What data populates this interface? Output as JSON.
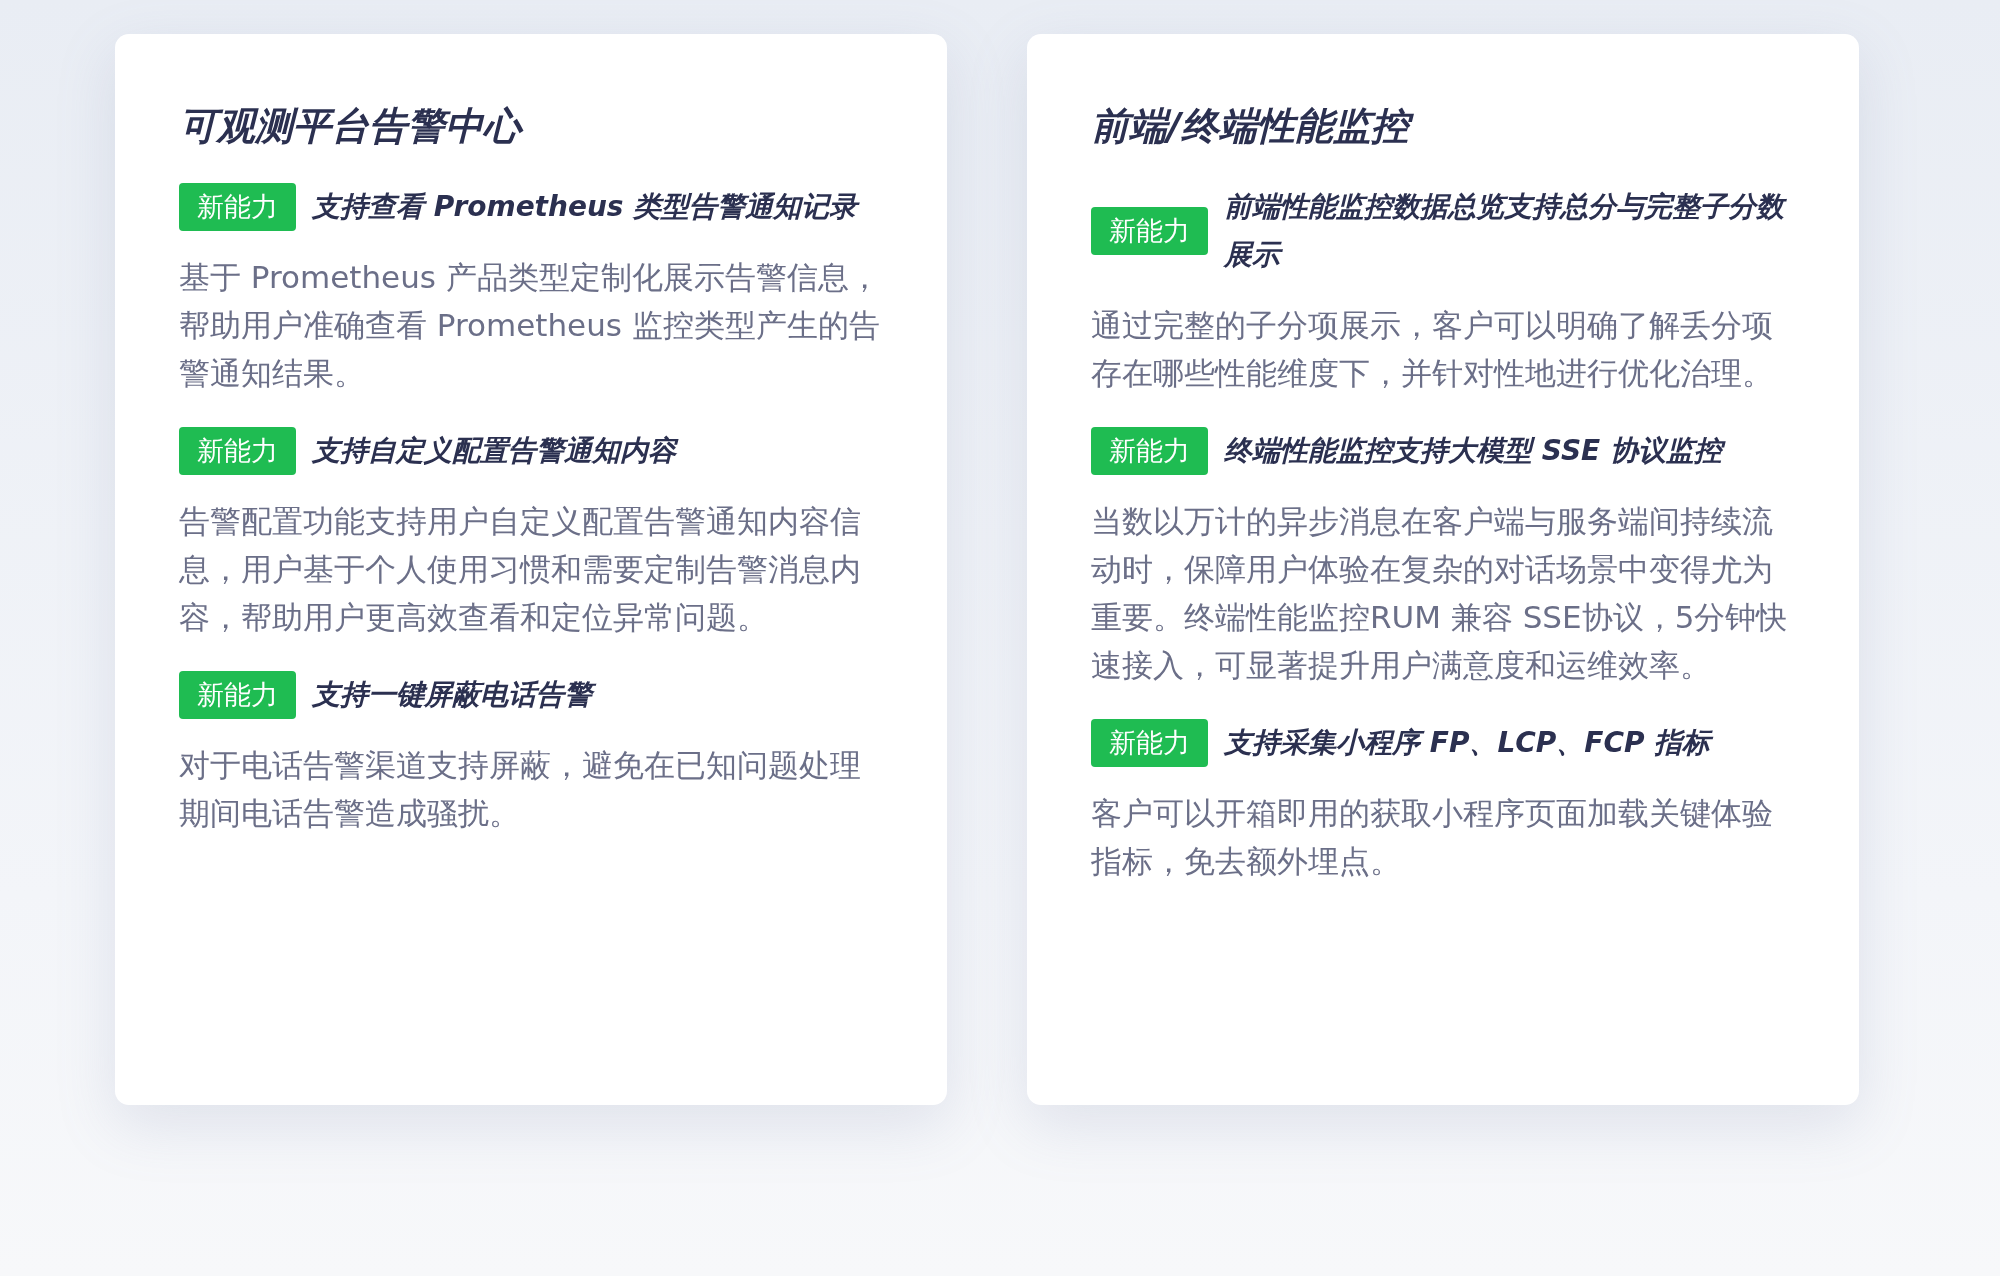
{
  "cards": [
    {
      "title": "可观测平台告警中心",
      "items": [
        {
          "badge": "新能力",
          "heading": "支持查看 Prometheus 类型告警通知记录",
          "body": "基于 Prometheus 产品类型定制化展示告警信息，帮助用户准确查看 Prometheus 监控类型产生的告警通知结果。"
        },
        {
          "badge": "新能力",
          "heading": "支持自定义配置告警通知内容",
          "body": "告警配置功能支持用户自定义配置告警通知内容信息，用户基于个人使用习惯和需要定制告警消息内容，帮助用户更高效查看和定位异常问题。"
        },
        {
          "badge": "新能力",
          "heading": "支持一键屏蔽电话告警",
          "body": "对于电话告警渠道支持屏蔽，避免在已知问题处理期间电话告警造成骚扰。"
        }
      ]
    },
    {
      "title": "前端/终端性能监控",
      "items": [
        {
          "badge": "新能力",
          "heading": "前端性能监控数据总览支持总分与完整子分数展示",
          "body": "通过完整的子分项展示，客户可以明确了解丢分项存在哪些性能维度下，并针对性地进行优化治理。"
        },
        {
          "badge": "新能力",
          "heading": "终端性能监控支持大模型 SSE 协议监控",
          "body": "当数以万计的异步消息在客户端与服务端间持续流动时，保障用户体验在复杂的对话场景中变得尤为重要。终端性能监控RUM 兼容 SSE协议，5分钟快速接入，可显著提升用户满意度和运维效率。"
        },
        {
          "badge": "新能力",
          "heading": "支持采集小程序 FP、LCP、FCP 指标",
          "body": "客户可以开箱即用的获取小程序页面加载关键体验指标，免去额外埋点。"
        }
      ]
    }
  ]
}
